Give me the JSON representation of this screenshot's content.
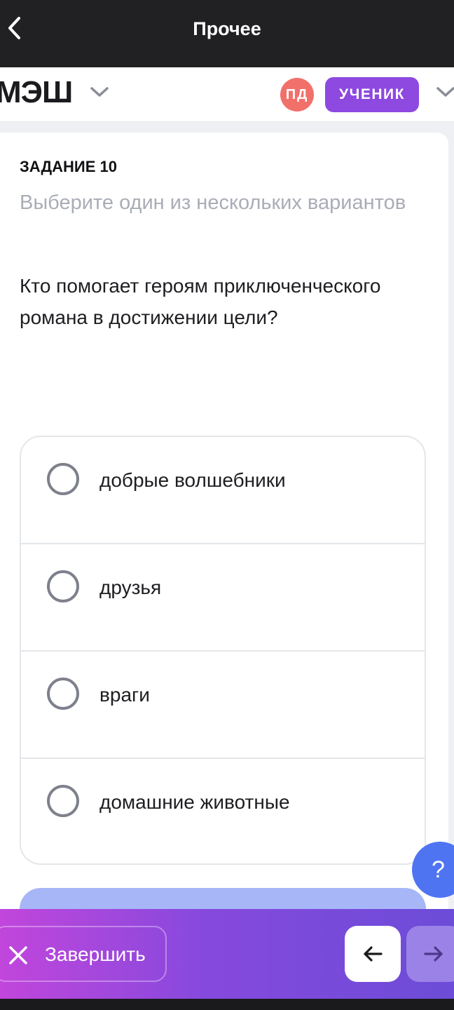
{
  "topbar": {
    "title": "Прочее",
    "back_icon": "chevron-left-icon"
  },
  "header": {
    "logo_text": "МЭШ",
    "avatar_initials": "ПД",
    "role_label": "УЧЕНИК",
    "colors": {
      "avatar": "#f2706a",
      "role_badge": "#8d49e0"
    }
  },
  "task": {
    "label": "ЗАДАНИЕ 10",
    "hint": "Выберите один из нескольких вариантов",
    "question": "Кто помогает героям приключенческого романа  в достижении цели?",
    "options": [
      {
        "label": "добрые волшебники"
      },
      {
        "label": "друзья"
      },
      {
        "label": "враги"
      },
      {
        "label": "домашние животные"
      }
    ]
  },
  "help": {
    "label": "?"
  },
  "bottombar": {
    "finish_label": "Завершить",
    "finish_icon": "close-icon",
    "prev_icon": "arrow-left-icon",
    "next_icon": "arrow-right-icon"
  }
}
